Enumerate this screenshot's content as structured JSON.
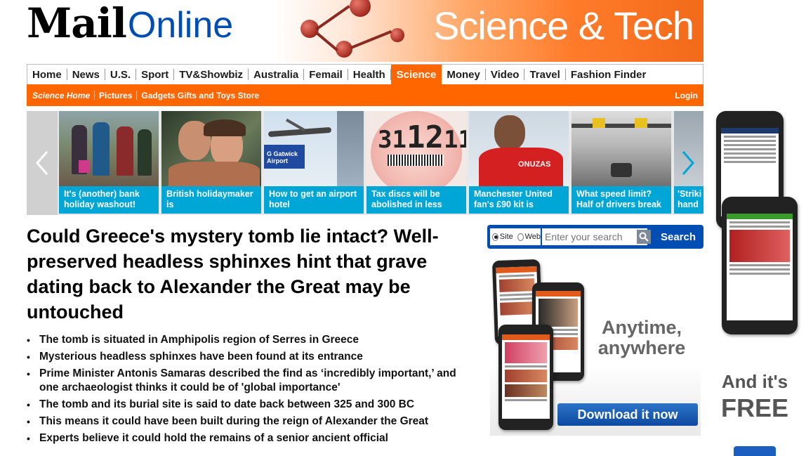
{
  "header": {
    "logo_mail": "Mail",
    "logo_online": "Online",
    "section_banner": "Science & Tech"
  },
  "nav": {
    "items": [
      "Home",
      "News",
      "U.S.",
      "Sport",
      "TV&Showbiz",
      "Australia",
      "Femail",
      "Health",
      "Science",
      "Money",
      "Video",
      "Travel",
      "Fashion Finder"
    ],
    "active": "Science"
  },
  "subnav": {
    "items": [
      "Science Home",
      "Pictures",
      "Gadgets Gifts and Toys Store"
    ],
    "login": "Login"
  },
  "carousel": {
    "cards": [
      {
        "caption": "It's (another) bank holiday washout!"
      },
      {
        "caption": "British holidaymaker is"
      },
      {
        "caption": "How to get an airport hotel"
      },
      {
        "caption": "Tax discs will be abolished in less"
      },
      {
        "caption": "Manchester United fan's £90 kit is"
      },
      {
        "caption": "What speed limit? Half of drivers break"
      },
      {
        "caption": "'Striki hand"
      }
    ]
  },
  "article": {
    "headline": "Could Greece's mystery tomb lie intact? Well-preserved headless sphinxes hint that grave dating back to Alexander the Great may be untouched",
    "bullets": [
      "The tomb is situated in Amphipolis region of Serres in Greece",
      "Mysterious headless sphinxes have been found at its entrance",
      "Prime Minister Antonis Samaras described the find as ‘incredibly important,’ and one archaeologist thinks it could be of 'global importance'",
      "The tomb and its burial site is said to date back between 325 and 300 BC",
      "This means it could have been built during the reign of Alexander the Great",
      "Experts believe it could hold the remains of a senior ancient official"
    ]
  },
  "search": {
    "option_site": "Site",
    "option_web": "Web",
    "placeholder": "Enter your search",
    "button": "Search",
    "selected": "Site"
  },
  "ad": {
    "tagline": "Anytime, anywhere",
    "cta": "Download it now"
  },
  "right_ad": {
    "line1": "And it's",
    "line2": "FREE"
  },
  "colors": {
    "accent_orange": "#ff6600",
    "caption_blue": "#00a6d6",
    "brand_blue": "#004db3"
  }
}
